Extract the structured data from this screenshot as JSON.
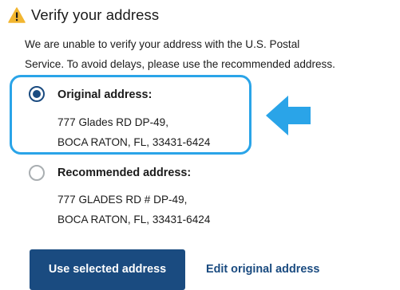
{
  "header": {
    "title": "Verify your address",
    "icon": "warning-icon"
  },
  "message": {
    "line1": "We are unable to verify your address with the U.S. Postal",
    "line2": "Service. To avoid delays, please use the recommended address."
  },
  "options": {
    "original": {
      "label": "Original address:",
      "line1": "777 Glades RD DP-49,",
      "line2": "BOCA RATON, FL, 33431-6424",
      "selected": true
    },
    "recommended": {
      "label": "Recommended address:",
      "line1": "777 GLADES RD # DP-49,",
      "line2": "BOCA RATON, FL, 33431-6424",
      "selected": false
    }
  },
  "actions": {
    "use_selected_label": "Use selected address",
    "edit_original_label": "Edit original address"
  },
  "colors": {
    "primary": "#1a4b80",
    "highlight": "#2aa4e8",
    "warning": "#f2b630",
    "text": "#1b1b1b"
  }
}
